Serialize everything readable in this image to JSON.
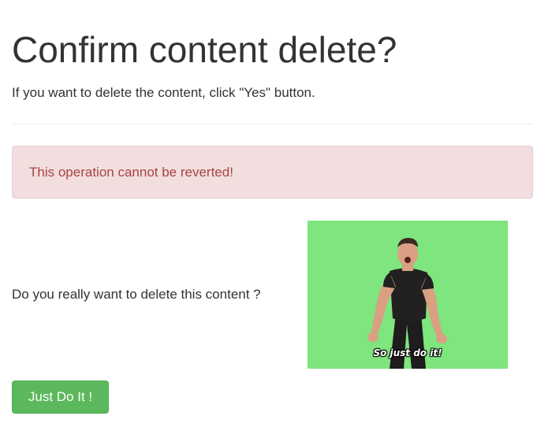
{
  "page": {
    "title": "Confirm content delete?",
    "subtitle": "If you want to delete the content, click \"Yes\" button."
  },
  "alert": {
    "message": "This operation cannot be reverted!",
    "colors": {
      "background": "#f2dede",
      "border": "#ebccd1",
      "text": "#a94442"
    }
  },
  "confirm": {
    "question": "Do you really want to delete this content ?",
    "image": {
      "icon": "just-do-it-gif",
      "caption": "So just do it!",
      "background_color": "#7fe57e"
    },
    "button_label": "Just Do It !",
    "button_color": "#5cb85c"
  }
}
